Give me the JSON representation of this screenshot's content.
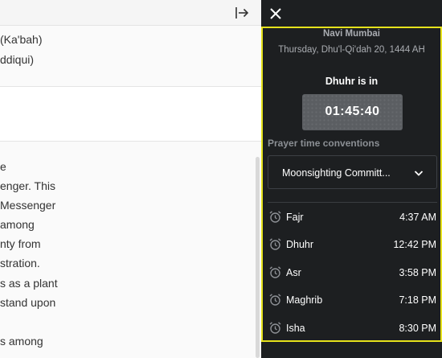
{
  "reader": {
    "refs": [
      "(Ka'bah)",
      "ddiqui)"
    ],
    "lines": [
      "e",
      "enger. This",
      "Messenger",
      "among",
      "nty from",
      "stration.",
      "s as a plant",
      " stand upon",
      "",
      "s among"
    ]
  },
  "prayer": {
    "city": "Navi Mumbai",
    "date": "Thursday, Dhu'l-Qi'dah 20, 1444 AH",
    "next_label": "Dhuhr is in",
    "countdown": "01:45:40",
    "conventions_label": "Prayer time conventions",
    "convention_selected": "Moonsighting Committ...",
    "times": [
      {
        "name": "Fajr",
        "time": "4:37 AM"
      },
      {
        "name": "Dhuhr",
        "time": "12:42 PM"
      },
      {
        "name": "Asr",
        "time": "3:58 PM"
      },
      {
        "name": "Maghrib",
        "time": "7:18 PM"
      },
      {
        "name": "Isha",
        "time": "8:30 PM"
      }
    ],
    "highlight_color": "#e6e21c",
    "panel_bg": "#1d1f21"
  },
  "icons": {
    "close": "close-icon",
    "collapse": "collapse-panel-icon",
    "chevron": "chevron-down-icon",
    "alarm": "alarm-clock-icon"
  }
}
